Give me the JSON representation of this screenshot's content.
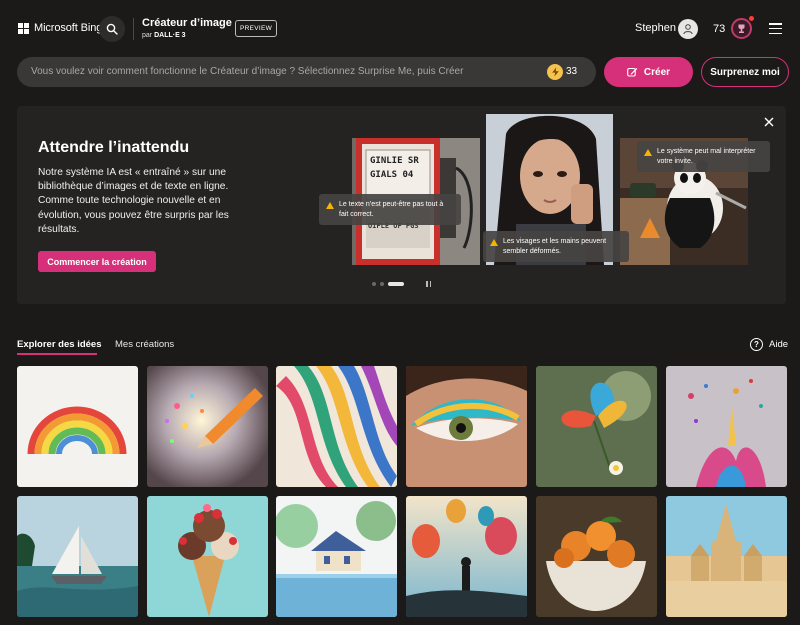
{
  "header": {
    "brand": "Microsoft Bing",
    "app_title": "Créateur d’image",
    "app_sub_prefix": "par",
    "app_sub_model": "DALL·E 3",
    "preview_label": "PREVIEW",
    "user_name": "Stephen",
    "reward_count": "73"
  },
  "prompt": {
    "placeholder": "Vous voulez voir comment fonctionne le Créateur d’image ? Sélectionnez Surprise Me, puis Créer",
    "boost_count": "33",
    "create_label": "Créer",
    "surprise_label": "Surprenez moi"
  },
  "banner": {
    "title": "Attendre l’inattendu",
    "body": "Notre système IA est « entraîné » sur une bibliothèque d’images et de texte en ligne. Comme toute technologie nouvelle et en évolution, vous pouvez être surpris par les résultats.",
    "cta_label": "Commencer la création",
    "tips": [
      "Le texte n’est peut-être pas tout à fait correct.",
      "Les visages et les mains peuvent sembler déformés.",
      "Le système peut mal interpréter votre invite."
    ],
    "pump_text": [
      "GINLIE SR",
      "GIALS 04",
      "OIFLE OF PGS"
    ]
  },
  "tabs": {
    "explore": "Explorer des idées",
    "mine": "Mes créations",
    "help": "Aide"
  },
  "colors": {
    "accent": "#d6307a",
    "background": "#1b1a19",
    "banner_bg": "#242322"
  }
}
